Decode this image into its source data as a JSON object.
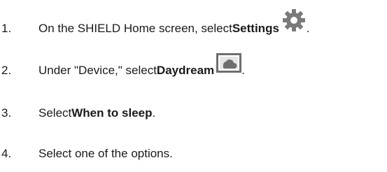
{
  "steps": [
    {
      "number": "1.",
      "before": "On the SHIELD Home screen, select ",
      "bold": "Settings",
      "after": ".",
      "icon": "gear-icon",
      "icon_color": "#7a7a7a"
    },
    {
      "number": "2.",
      "before": "Under \"Device,\" select ",
      "bold": "Daydream",
      "after": ".",
      "icon": "daydream-icon",
      "icon_color": "#6e6e6e"
    },
    {
      "number": "3.",
      "before": "Select ",
      "bold": "When to sleep",
      "after": "."
    },
    {
      "number": "4.",
      "text": "Select one of the options."
    }
  ]
}
